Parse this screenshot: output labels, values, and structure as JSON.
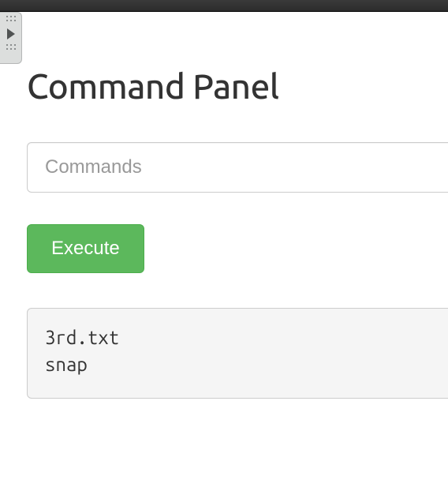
{
  "header": {
    "title": "Command Panel"
  },
  "form": {
    "command_placeholder": "Commands",
    "command_value": "",
    "execute_label": "Execute"
  },
  "output": {
    "text": "3rd.txt\nsnap"
  }
}
